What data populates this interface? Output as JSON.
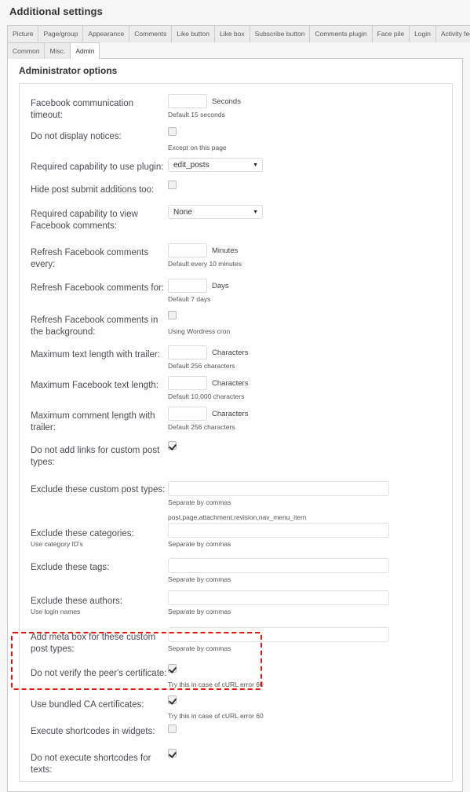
{
  "page": {
    "title": "Additional settings"
  },
  "tabs_primary": [
    {
      "label": "Picture",
      "active": false
    },
    {
      "label": "Page/group",
      "active": false
    },
    {
      "label": "Appearance",
      "active": false
    },
    {
      "label": "Comments",
      "active": false
    },
    {
      "label": "Like button",
      "active": false
    },
    {
      "label": "Like box",
      "active": false
    },
    {
      "label": "Subscribe button",
      "active": false
    },
    {
      "label": "Comments plugin",
      "active": false
    },
    {
      "label": "Face pile",
      "active": false
    },
    {
      "label": "Login",
      "active": false
    },
    {
      "label": "Activity feed",
      "active": false
    }
  ],
  "tabs_secondary": [
    {
      "label": "Common",
      "active": false
    },
    {
      "label": "Misc.",
      "active": false
    },
    {
      "label": "Admin",
      "active": true
    }
  ],
  "panel": {
    "heading": "Administrator options"
  },
  "fields": {
    "timeout": {
      "label": "Facebook communication timeout:",
      "value": "",
      "unit": "Seconds",
      "hint": "Default 15 seconds"
    },
    "no_notices": {
      "label": "Do not display notices:",
      "checked": false,
      "hint": "Except on this page"
    },
    "cap_use_plugin": {
      "label": "Required capability to use plugin:",
      "value": "edit_posts",
      "caret": "▼"
    },
    "hide_post_submit": {
      "label": "Hide post submit additions too:",
      "checked": false
    },
    "cap_view_comments": {
      "label": "Required capability to view Facebook comments:",
      "value": "None",
      "caret": "▼"
    },
    "refresh_every": {
      "label": "Refresh Facebook comments every:",
      "value": "",
      "unit": "Minutes",
      "hint": "Default every 10 minutes"
    },
    "refresh_for": {
      "label": "Refresh Facebook comments for:",
      "value": "",
      "unit": "Days",
      "hint": "Default 7 days"
    },
    "refresh_background": {
      "label": "Refresh Facebook comments in the background:",
      "checked": false,
      "hint": "Using Wordress cron"
    },
    "max_text_trailer": {
      "label": "Maximum text length with trailer:",
      "value": "",
      "unit": "Characters",
      "hint": "Default 256 characters"
    },
    "max_fb_text": {
      "label": "Maximum Facebook text length:",
      "value": "",
      "unit": "Characters",
      "hint": "Default 10,000 characters"
    },
    "max_comment_trailer": {
      "label": "Maximum comment length with trailer:",
      "value": "",
      "unit": "Characters",
      "hint": "Default 256 characters"
    },
    "no_links_cpt": {
      "label": "Do not add links for custom post types:",
      "checked": true
    },
    "exclude_cpt": {
      "label": "Exclude these custom post types:",
      "value": "",
      "hint": "Separate by commas",
      "hint2": "post,page,attachment,revision,nav_menu_item"
    },
    "exclude_categories": {
      "label": "Exclude these categories:",
      "sub_label": "Use category ID's",
      "value": "",
      "hint": "Separate by commas"
    },
    "exclude_tags": {
      "label": "Exclude these tags:",
      "value": "",
      "hint": "Separate by commas"
    },
    "exclude_authors": {
      "label": "Exclude these authors:",
      "sub_label": "Use login names",
      "value": "",
      "hint": "Separate by commas"
    },
    "meta_box_cpt": {
      "label": "Add meta box for these custom post types:",
      "value": "",
      "hint": "Separate by commas"
    },
    "no_verify_peer": {
      "label": "Do not verify the peer's certificate:",
      "checked": true,
      "hint": "Try this in case of cURL error 60"
    },
    "bundled_ca": {
      "label": "Use bundled CA certificates:",
      "checked": true,
      "hint": "Try this in case of cURL error 60"
    },
    "shortcodes_widgets": {
      "label": "Execute shortcodes in widgets:",
      "checked": false
    },
    "no_shortcodes_texts": {
      "label": "Do not execute shortcodes for texts:",
      "checked": true
    }
  },
  "annotation": {
    "color": "#ee1111",
    "style": "dashed-rectangle"
  }
}
